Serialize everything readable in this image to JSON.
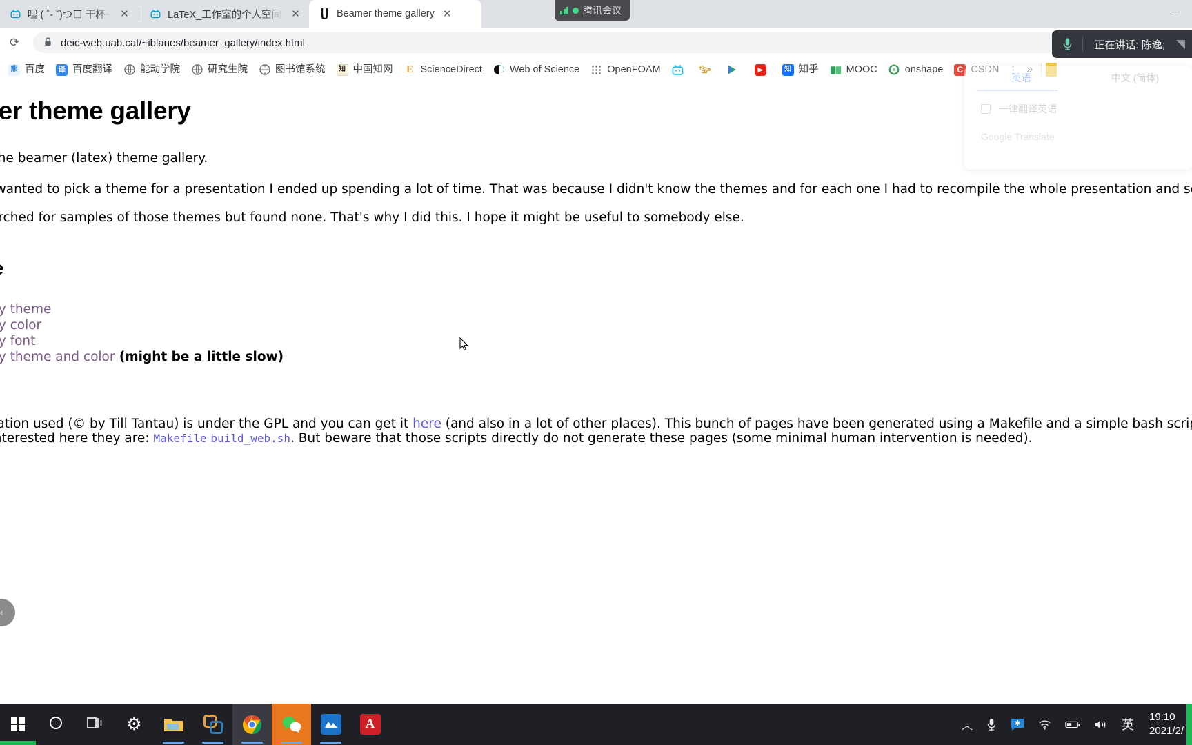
{
  "browser": {
    "tabs": [
      {
        "title": "哩 ( ˚- ˚)つ口 干杯~-bili",
        "favicon": "bilibili-icon",
        "active": false,
        "close_label": "✕"
      },
      {
        "title": "LaTeX_工作室的个人空间 - 哔哩",
        "favicon": "bilibili-icon",
        "active": false,
        "close_label": "✕"
      },
      {
        "title": "Beamer theme gallery",
        "favicon": "beamer-icon",
        "active": true,
        "close_label": "✕"
      }
    ],
    "window_controls": {
      "minimize": "—",
      "maximize": "▢",
      "close": "✕"
    },
    "toolbar": {
      "reload_glyph": "⟳",
      "lock_glyph": "🔒",
      "url": "deic-web.uab.cat/~iblanes/beamer_gallery/index.html"
    },
    "bookmarks": [
      {
        "label": "百度",
        "icon": "baidu-icon",
        "icon_text": "熊",
        "color": "#e8f3fd",
        "text_color": "#2b7fd4"
      },
      {
        "label": "百度翻译",
        "icon": "baidu-translate-icon",
        "icon_text": "译",
        "color": "#2f86ec",
        "text_color": "#ffffff"
      },
      {
        "label": "能动学院",
        "icon": "globe-icon",
        "icon_text": "🌐",
        "color": "transparent",
        "text_color": "#6b7075"
      },
      {
        "label": "研究生院",
        "icon": "globe-icon",
        "icon_text": "🌐",
        "color": "transparent",
        "text_color": "#6b7075"
      },
      {
        "label": "图书馆系统",
        "icon": "globe-icon",
        "icon_text": "🌐",
        "color": "transparent",
        "text_color": "#6b7075"
      },
      {
        "label": "中国知网",
        "icon": "cnki-icon",
        "icon_text": "知",
        "color": "#fdf6e3",
        "text_color": "#1a1a1a"
      },
      {
        "label": "ScienceDirect",
        "icon": "sciencedirect-icon",
        "icon_text": "E",
        "color": "transparent",
        "text_color": "#e9a23b"
      },
      {
        "label": "Web of Science",
        "icon": "web-of-science-icon",
        "icon_text": "◖",
        "color": "transparent",
        "text_color": "#1aa44b"
      },
      {
        "label": "OpenFOAM",
        "icon": "grid-apps-icon",
        "icon_text": "⣿",
        "color": "transparent",
        "text_color": "#5f6368"
      },
      {
        "label": "",
        "icon": "bilibili-icon",
        "icon_text": "tv",
        "color": "#22c0e8",
        "text_color": "#ffffff"
      },
      {
        "label": "",
        "icon": "sogou-icon",
        "icon_text": "搜",
        "color": "transparent",
        "text_color": "#d4a017"
      },
      {
        "label": "",
        "icon": "play-icon",
        "icon_text": "▶",
        "color": "transparent",
        "text_color": "#2eae4e"
      },
      {
        "label": "",
        "icon": "youtube-icon",
        "icon_text": "▶",
        "color": "#e62117",
        "text_color": "#ffffff"
      },
      {
        "label": "知乎",
        "icon": "zhihu-icon",
        "icon_text": "知",
        "color": "#0f6fff",
        "text_color": "#ffffff"
      },
      {
        "label": "MOOC",
        "icon": "mooc-icon",
        "icon_text": "📖",
        "color": "transparent",
        "text_color": "#2e9e5b"
      },
      {
        "label": "onshape",
        "icon": "onshape-icon",
        "icon_text": "◎",
        "color": "transparent",
        "text_color": "#3a9a58"
      },
      {
        "label": "CSDN",
        "icon": "csdn-icon",
        "icon_text": "C",
        "color": "#e8483c",
        "text_color": "#ffffff"
      }
    ],
    "bookmarks_more_dots": "⋮",
    "bookmarks_overflow": "»",
    "bookmarks_close": "✕"
  },
  "translate_popup": {
    "tab_source": "英语",
    "tab_target": "中文 (简体)",
    "checkbox_label": "一律翻译英语",
    "footer": "Google Translate"
  },
  "meeting": {
    "chip_label": "腾讯会议",
    "mic_icon": "microphone-icon",
    "speaking_label": "正在讲话: 陈逸;",
    "grip_icon": "drag-handle-icon"
  },
  "page": {
    "title": "mer theme gallery",
    "intro": "to the beamer (latex) theme gallery.",
    "para_1": "e I wanted to pick a theme for a presentation I ended up spending a lot of time. That was because I didn't know the themes and for each one I had to recompile the whole presentation and see",
    "para_2": "searched for samples of those themes but found none. That's why I did this. I hope it might be useful to somebody else.",
    "heading_2": "ate",
    "nav_links": [
      {
        "text": "w by theme",
        "note": ""
      },
      {
        "text": "w by color",
        "note": ""
      },
      {
        "text": "w by font",
        "note": ""
      },
      {
        "text": "w by theme and color",
        "note": " (might be a little slow)"
      }
    ],
    "footer_line_1_a": "entation used (© by Till Tantau) is under the GPL and you can get it ",
    "footer_link_here": "here",
    "footer_line_1_b": " (and also in a lot of other places). This bunch of pages have been generated using a Makefile and a simple bash script. In",
    "footer_line_2_a": "is interested here they are: ",
    "footer_link_makefile": "Makefile",
    "footer_link_buildweb": "build_web.sh",
    "footer_line_2_b": ". But beware that those scripts directly do not generate these pages (some minimal human intervention is needed).",
    "scroll_left_glyph": "‹"
  },
  "taskbar": {
    "start_icon": "windows-start-icon",
    "items": [
      {
        "name": "cortana-search-icon",
        "glyph": "◯",
        "style": "plain"
      },
      {
        "name": "task-view-icon",
        "glyph": "❏",
        "style": "plain"
      },
      {
        "name": "settings-gear-icon",
        "glyph": "⚙",
        "style": "plain"
      },
      {
        "name": "file-explorer-icon",
        "glyph": "📁",
        "style": "running"
      },
      {
        "name": "virtualbox-icon",
        "glyph": "❐",
        "style": "running"
      },
      {
        "name": "google-chrome-icon",
        "glyph": "◉",
        "style": "focused"
      },
      {
        "name": "wechat-icon",
        "glyph": "💬",
        "style": "active"
      },
      {
        "name": "xmind-icon",
        "glyph": "◣",
        "style": "running"
      },
      {
        "name": "adobe-acrobat-icon",
        "glyph": "A",
        "style": "plain"
      }
    ],
    "tray": [
      {
        "name": "show-hidden-icons-chevron",
        "glyph": "︿"
      },
      {
        "name": "microphone-icon",
        "glyph": "🎤"
      },
      {
        "name": "message-icon",
        "glyph": "✱"
      },
      {
        "name": "wifi-icon",
        "glyph": "📶"
      },
      {
        "name": "battery-icon",
        "glyph": "▭"
      },
      {
        "name": "volume-icon",
        "glyph": "🔊"
      },
      {
        "name": "ime-language-indicator",
        "glyph": "英"
      }
    ],
    "clock_time": "19:10",
    "clock_date": "2021/2/"
  }
}
